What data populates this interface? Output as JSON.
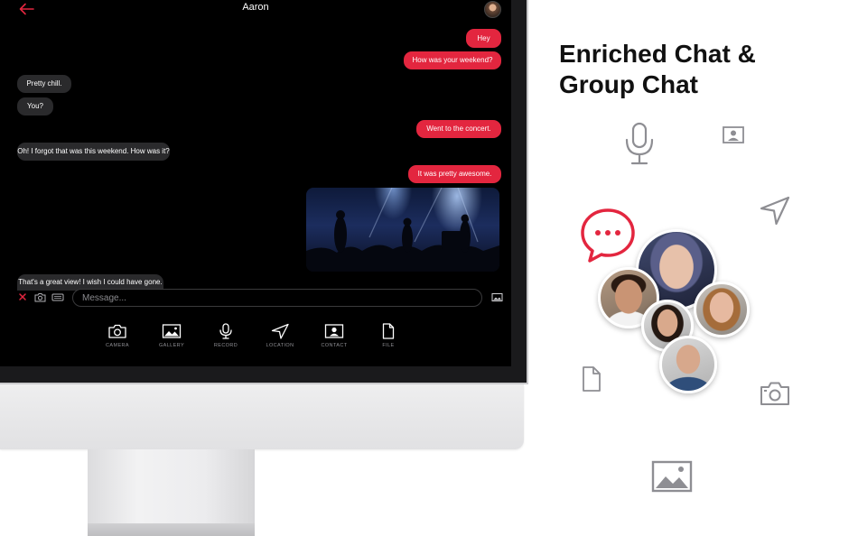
{
  "chat": {
    "title": "Aaron",
    "messages": [
      {
        "id": "m1",
        "dir": "out",
        "text": "Hey"
      },
      {
        "id": "m2",
        "dir": "out",
        "text": "How was your weekend?"
      },
      {
        "id": "m3",
        "dir": "in",
        "text": "Pretty chill."
      },
      {
        "id": "m4",
        "dir": "in",
        "text": "You?"
      },
      {
        "id": "m5",
        "dir": "out",
        "text": "Went to the concert."
      },
      {
        "id": "m6",
        "dir": "in",
        "text": "Oh! I forgot that was this weekend. How was it?"
      },
      {
        "id": "m7",
        "dir": "out",
        "text": "It was pretty awesome."
      },
      {
        "id": "m8",
        "dir": "in",
        "text": "That's a great view! I wish I could have gone."
      }
    ],
    "composer": {
      "placeholder": "Message..."
    },
    "attachments": [
      {
        "id": "camera",
        "label": "CAMERA",
        "icon": "camera-icon"
      },
      {
        "id": "gallery",
        "label": "GALLERY",
        "icon": "image-icon"
      },
      {
        "id": "record",
        "label": "RECORD",
        "icon": "microphone-icon"
      },
      {
        "id": "location",
        "label": "LOCATION",
        "icon": "location-arrow-icon"
      },
      {
        "id": "contact",
        "label": "CONTACT",
        "icon": "contact-card-icon"
      },
      {
        "id": "file",
        "label": "FILE",
        "icon": "file-icon"
      }
    ]
  },
  "promo": {
    "headline_line1": "Enriched Chat &",
    "headline_line2": "Group Chat"
  },
  "colors": {
    "accent": "#e3263f",
    "incoming_bubble": "#2a2a2c",
    "screen_bg": "#000000",
    "icon_gray": "#8e8e93"
  }
}
